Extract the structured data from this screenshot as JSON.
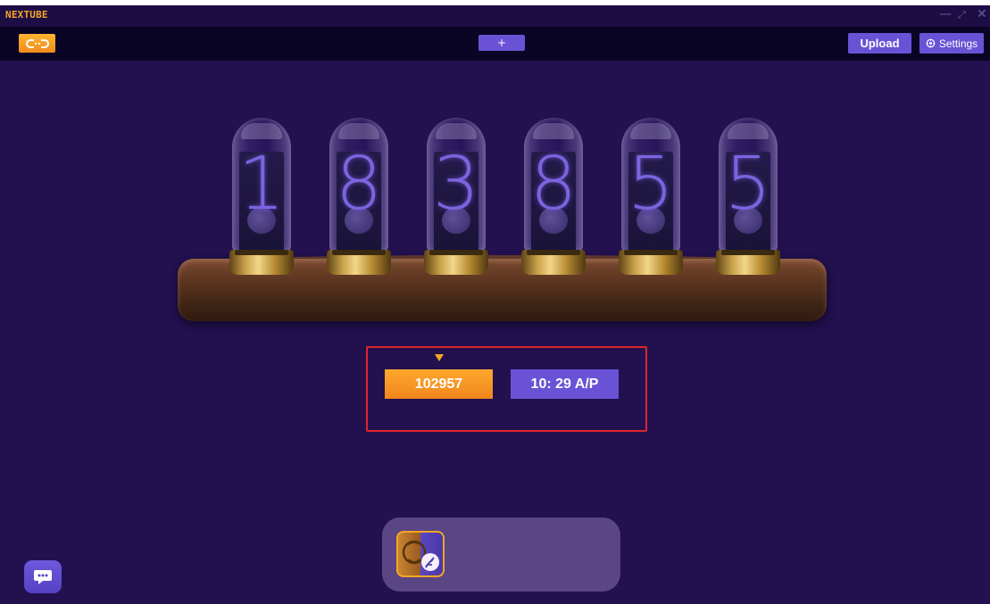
{
  "app": {
    "title": "NEXTUBE",
    "background_color": "#22104f",
    "accent_color": "#6a52d6",
    "highlight_color": "#f5a623"
  },
  "window_controls": {
    "minimize": "—",
    "restore": "⤢",
    "close": "✕"
  },
  "toolbar": {
    "link_icon": "link-icon",
    "add_label": "+",
    "upload_label": "Upload",
    "settings_label": "Settings",
    "settings_icon": "gear-icon"
  },
  "nixie_clock": {
    "digits": [
      "1",
      "8",
      "3",
      "8",
      "5",
      "5"
    ]
  },
  "display_modes": {
    "selected_index": 0,
    "items": [
      {
        "label": "102957",
        "selected": true
      },
      {
        "label": "10: 29 A/P",
        "selected": false
      }
    ]
  },
  "dock": {
    "apps": [
      {
        "icon": "nextube-app-icon"
      }
    ]
  },
  "chat": {
    "icon": "chat-icon"
  }
}
